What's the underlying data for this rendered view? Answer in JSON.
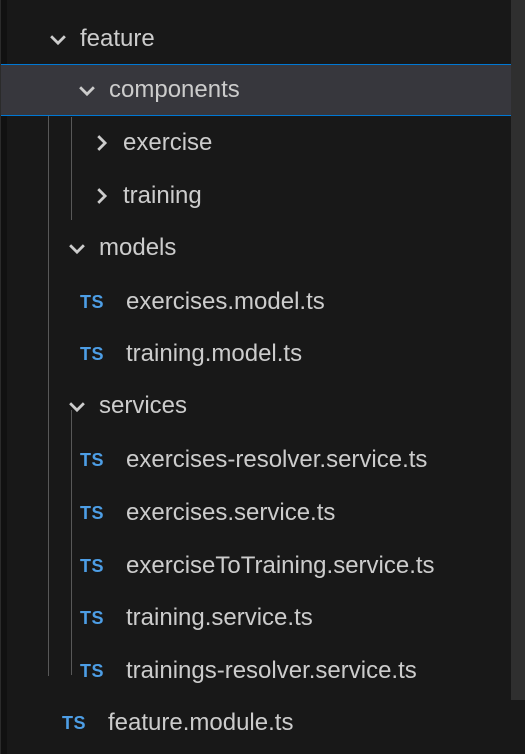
{
  "explorer": {
    "rows": [
      {
        "type": "folder",
        "label": "feature",
        "expanded": true,
        "depth": 0
      },
      {
        "type": "folder",
        "label": "components",
        "expanded": true,
        "depth": 1,
        "selected": true
      },
      {
        "type": "folder",
        "label": "exercise",
        "expanded": false,
        "depth": 2
      },
      {
        "type": "folder",
        "label": "training",
        "expanded": false,
        "depth": 2
      },
      {
        "type": "folder",
        "label": "models",
        "expanded": true,
        "depth": 1
      },
      {
        "type": "file",
        "icon": "TS",
        "label": "exercises.model.ts",
        "depth": 2
      },
      {
        "type": "file",
        "icon": "TS",
        "label": "training.model.ts",
        "depth": 2
      },
      {
        "type": "folder",
        "label": "services",
        "expanded": true,
        "depth": 1
      },
      {
        "type": "file",
        "icon": "TS",
        "label": "exercises-resolver.service.ts",
        "depth": 2
      },
      {
        "type": "file",
        "icon": "TS",
        "label": "exercises.service.ts",
        "depth": 2
      },
      {
        "type": "file",
        "icon": "TS",
        "label": "exerciseToTraining.service.ts",
        "depth": 2
      },
      {
        "type": "file",
        "icon": "TS",
        "label": "training.service.ts",
        "depth": 2
      },
      {
        "type": "file",
        "icon": "TS",
        "label": "trainings-resolver.service.ts",
        "depth": 2
      },
      {
        "type": "file",
        "icon": "TS",
        "label": "feature.module.ts",
        "depth": 1
      }
    ]
  },
  "colors": {
    "background": "#181818",
    "text": "#cccccc",
    "ts_icon": "#4d9ee6",
    "selection": "#37373d",
    "selection_border": "#0078d4"
  }
}
